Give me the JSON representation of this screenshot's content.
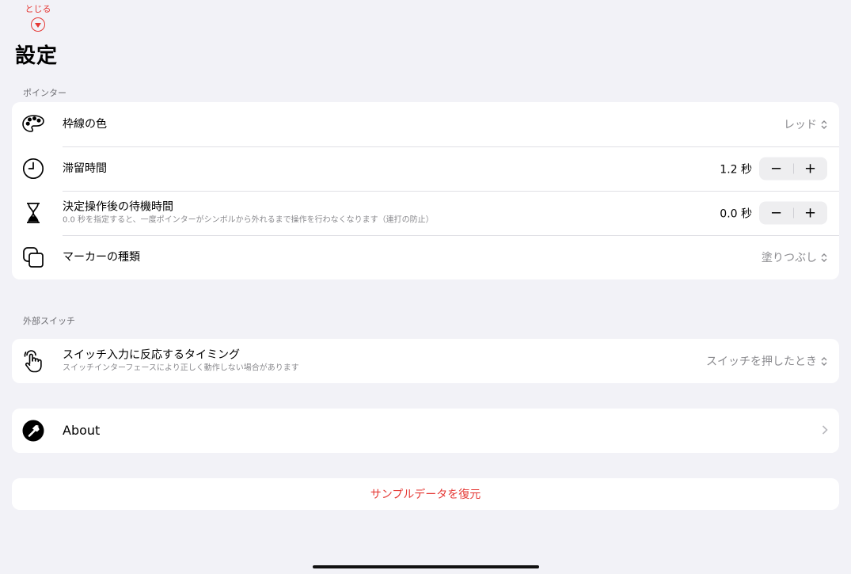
{
  "header": {
    "close_label": "とじる",
    "title": "設定"
  },
  "pointer_section": {
    "header": "ポインター",
    "rows": [
      {
        "title": "枠線の色",
        "value": "レッド",
        "icon": "palette-icon"
      },
      {
        "title": "滞留時間",
        "value": "1.2 秒",
        "icon": "clock-icon"
      },
      {
        "title": "決定操作後の待機時間",
        "subtitle": "0.0 秒を指定すると、一度ポインターがシンボルから外れるまで操作を行わなくなります（連打の防止）",
        "value": "0.0 秒",
        "icon": "hourglass-icon"
      },
      {
        "title": "マーカーの種類",
        "value": "塗りつぶし",
        "icon": "square-on-square-icon"
      }
    ]
  },
  "switch_section": {
    "header": "外部スイッチ",
    "rows": [
      {
        "title": "スイッチ入力に反応するタイミング",
        "subtitle": "スイッチインターフェースにより正しく動作しない場合があります",
        "value": "スイッチを押したとき",
        "icon": "hand-tap-icon"
      }
    ]
  },
  "about": {
    "label": "About",
    "icon": "hammer-icon"
  },
  "restore_label": "サンプルデータを復元",
  "stepper": {
    "minus": "−",
    "plus": "+"
  },
  "colors": {
    "accent": "#e53935",
    "background": "#f2f2f7",
    "secondary_text": "#8a8a8e"
  }
}
